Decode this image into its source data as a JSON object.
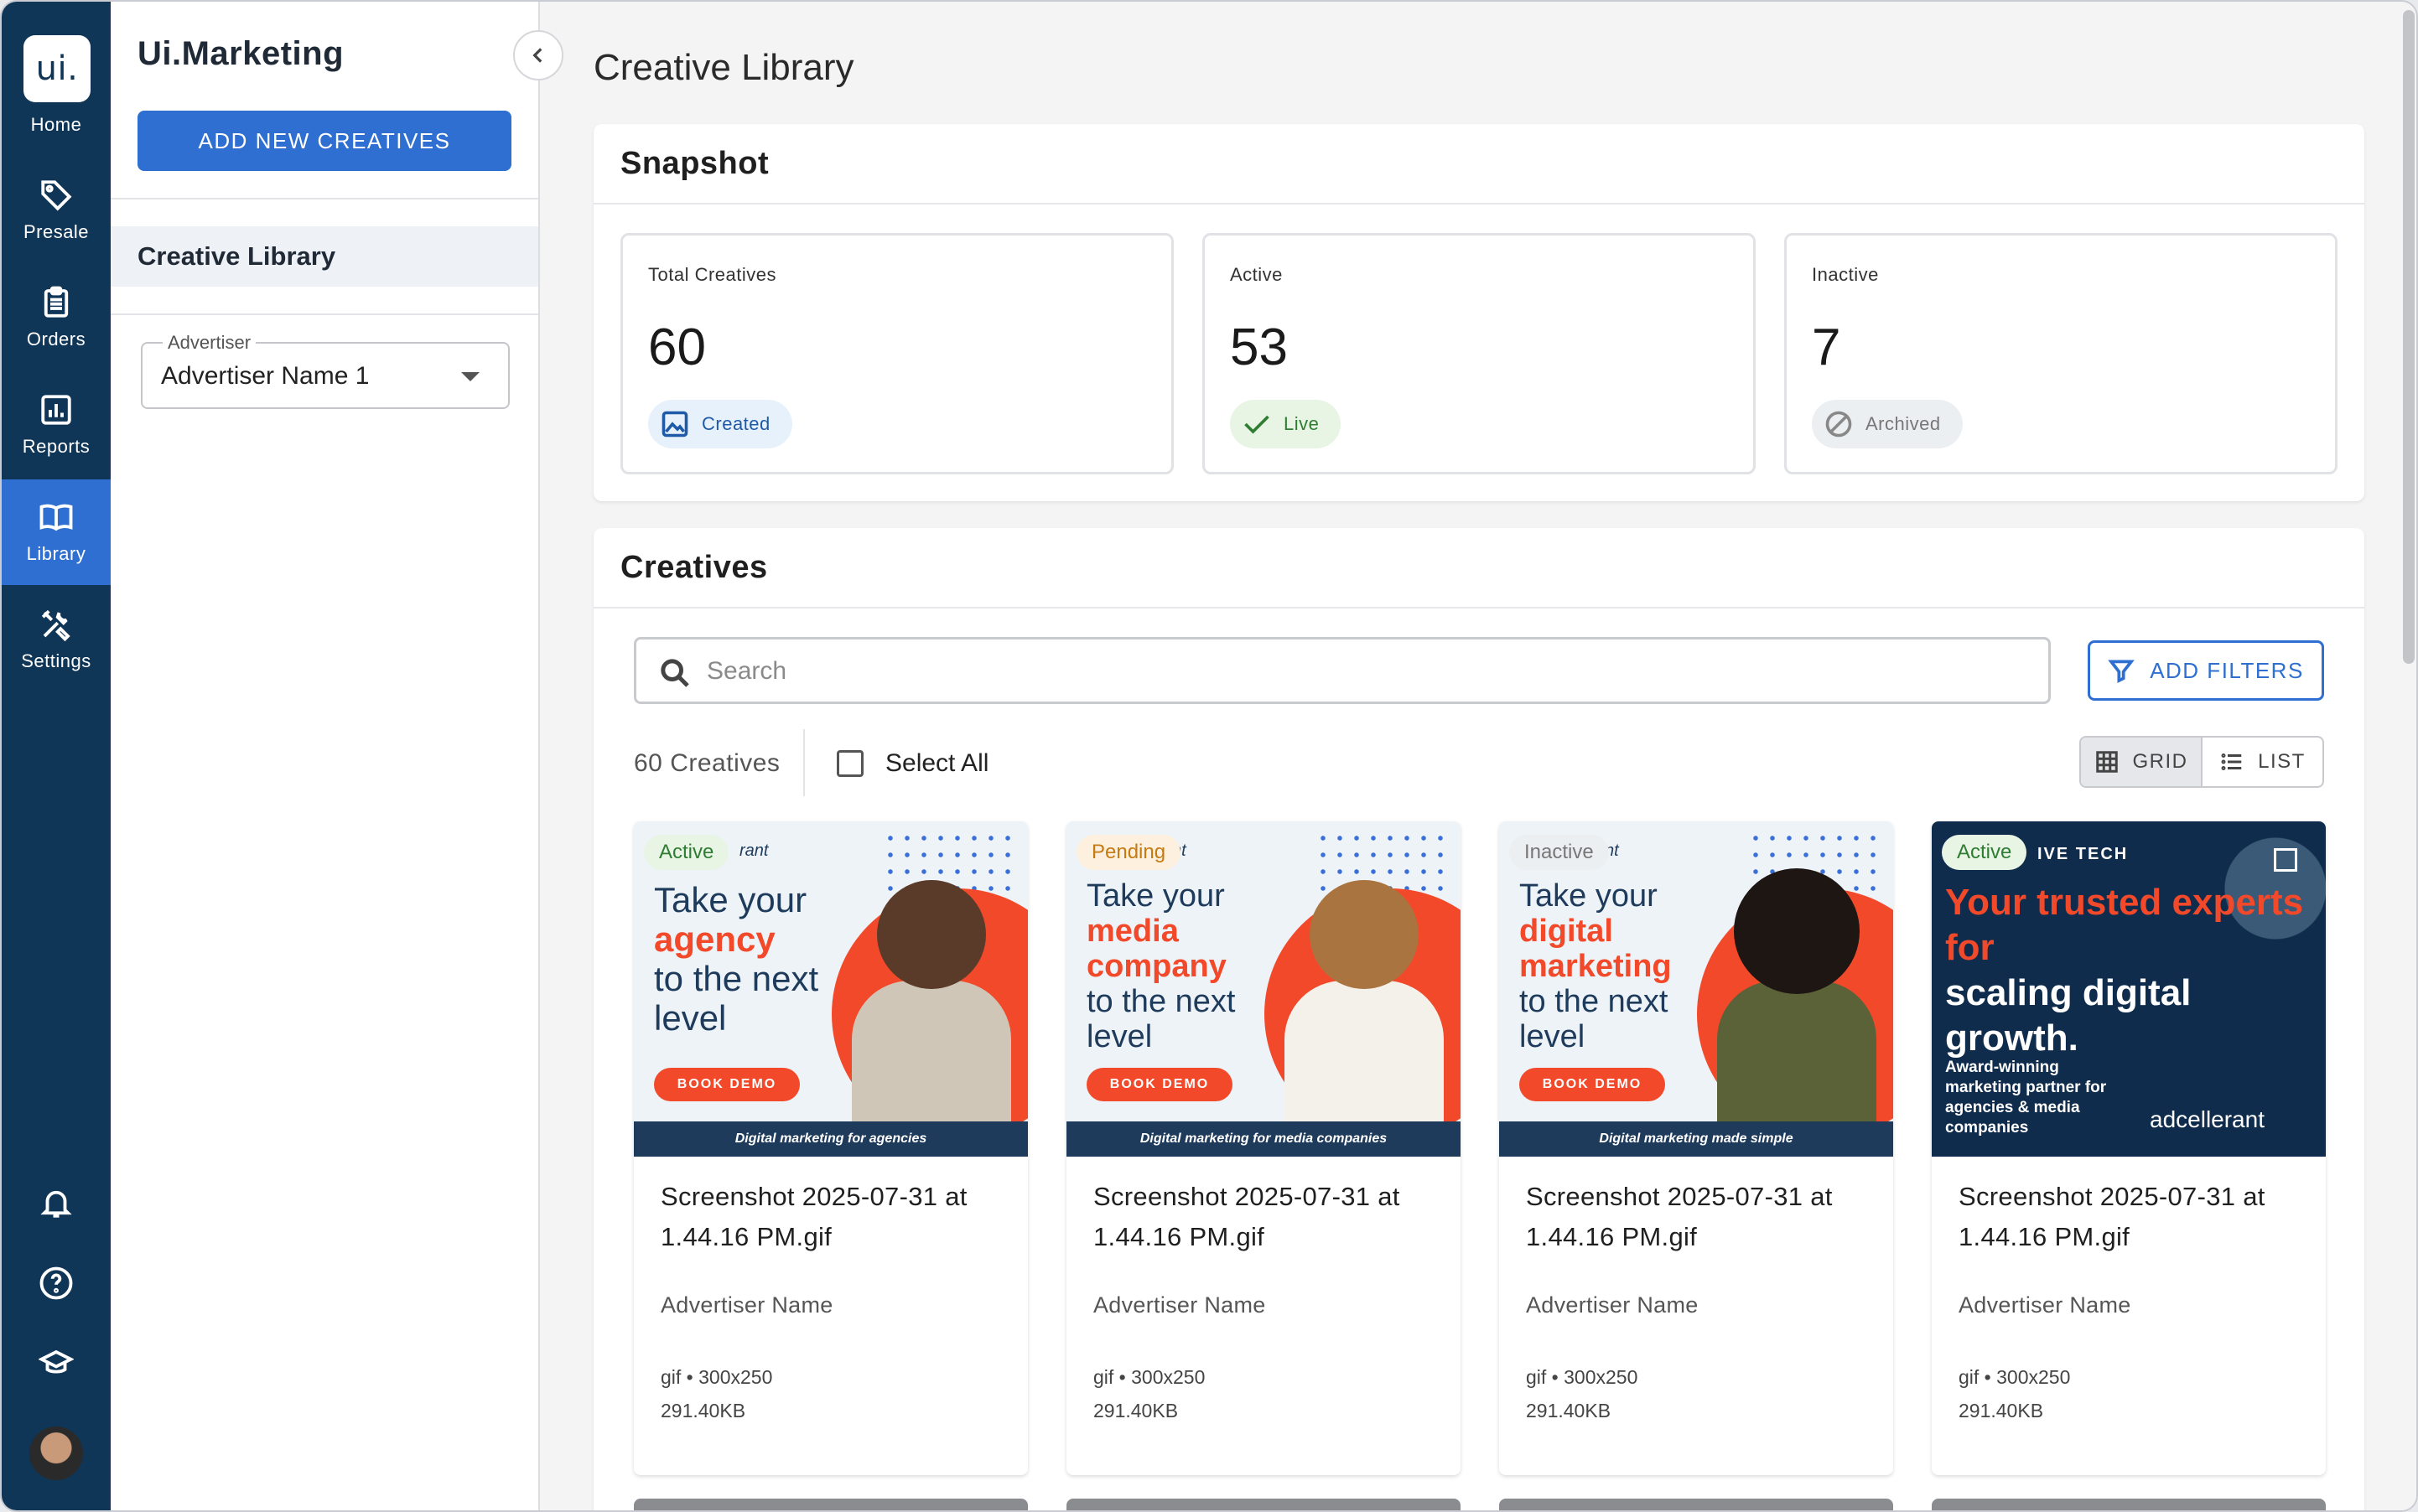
{
  "nav": {
    "logo": "ui.",
    "items": [
      {
        "label": "Home",
        "icon": "home-logo"
      },
      {
        "label": "Presale",
        "icon": "tag-icon"
      },
      {
        "label": "Orders",
        "icon": "clipboard-icon"
      },
      {
        "label": "Reports",
        "icon": "chart-icon"
      },
      {
        "label": "Library",
        "icon": "book-icon",
        "active": true
      },
      {
        "label": "Settings",
        "icon": "tools-icon"
      }
    ],
    "bottom_icons": [
      "bell-icon",
      "help-icon",
      "graduation-cap-icon",
      "avatar"
    ]
  },
  "panel": {
    "brand": "Ui.Marketing",
    "add_button": "ADD NEW CREATIVES",
    "section": "Creative Library",
    "advertiser_label": "Advertiser",
    "advertiser_value": "Advertiser Name 1"
  },
  "page": {
    "title": "Creative Library"
  },
  "snapshot": {
    "title": "Snapshot",
    "stats": [
      {
        "label": "Total Creatives",
        "value": "60",
        "chip": "Created",
        "chip_color": "#1e5aa8",
        "chip_bg": "#e6f1fb"
      },
      {
        "label": "Active",
        "value": "53",
        "chip": "Live",
        "chip_color": "#2e7d32",
        "chip_bg": "#e8f5e5"
      },
      {
        "label": "Inactive",
        "value": "7",
        "chip": "Archived",
        "chip_color": "#777777",
        "chip_bg": "#eceff1"
      }
    ]
  },
  "creatives": {
    "title": "Creatives",
    "search_placeholder": "Search",
    "filters_button": "ADD FILTERS",
    "count": "60 Creatives",
    "select_all": "Select All",
    "view_grid": "GRID",
    "view_list": "LIST",
    "tiles": [
      {
        "status": "Active",
        "thumb": {
          "brand": "rant",
          "headline_pre": "Take your",
          "headline_em": "agency",
          "headline_post": "to the next level",
          "cta": "BOOK DEMO",
          "footer": "Digital marketing for agencies"
        },
        "name": "Screenshot 2025-07-31 at 1.44.16 PM.gif",
        "advertiser": "Advertiser Name",
        "meta": "gif • 300x250",
        "size": "291.40KB"
      },
      {
        "status": "Pending",
        "thumb": {
          "brand": "nt",
          "headline_pre": "Take your",
          "headline_em": "media company",
          "headline_post": "to the next level",
          "cta": "BOOK DEMO",
          "footer": "Digital marketing for media companies"
        },
        "name": "Screenshot 2025-07-31 at 1.44.16 PM.gif",
        "advertiser": "Advertiser Name",
        "meta": "gif • 300x250",
        "size": "291.40KB"
      },
      {
        "status": "Inactive",
        "thumb": {
          "brand": "nt",
          "headline_pre": "Take your",
          "headline_em": "digital marketing",
          "headline_post": "to the next level",
          "cta": "BOOK DEMO",
          "footer": "Digital marketing made simple"
        },
        "name": "Screenshot 2025-07-31 at 1.44.16 PM.gif",
        "advertiser": "Advertiser Name",
        "meta": "gif • 300x250",
        "size": "291.40KB"
      },
      {
        "status": "Active",
        "thumb": {
          "brand": "IVE TECH",
          "headline_em": "Your trusted experts for",
          "headline_post": "scaling digital growth.",
          "tagline": "Award-winning marketing partner for agencies & media companies",
          "logo": "adcellerant"
        },
        "name": "Screenshot 2025-07-31 at 1.44.16 PM.gif",
        "advertiser": "Advertiser Name",
        "meta": "gif • 300x250",
        "size": "291.40KB"
      }
    ]
  }
}
